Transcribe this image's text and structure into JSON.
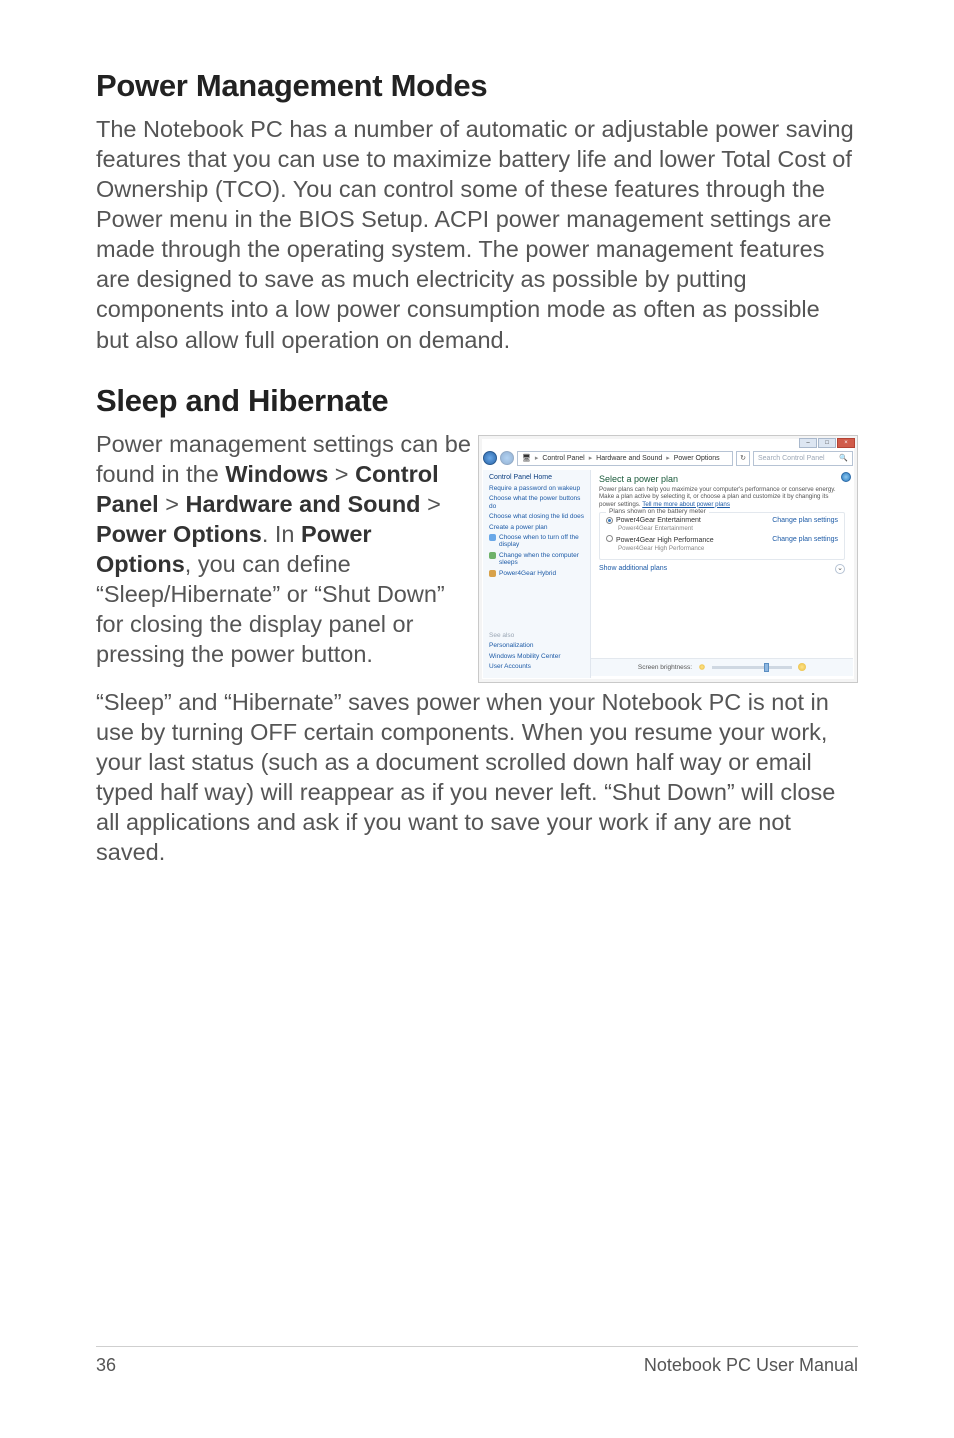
{
  "headings": {
    "h1": "Power Management Modes",
    "h2": "Sleep and Hibernate"
  },
  "paragraphs": {
    "p1": "The Notebook PC has a number of automatic or adjustable power saving features that you can use to maximize battery life and lower Total Cost of Ownership (TCO). You can control some of these features through the Power menu in the BIOS Setup. ACPI power management settings are made through the operating system. The power management features are designed to save as much electricity as possible by putting components into a low power consumption mode as often as possible but also allow full operation on demand.",
    "p2_pre": "Power management settings can be found in the ",
    "p2_w": "Windows",
    "p2_gt1": " > ",
    "p2_cp": "Control Panel",
    "p2_gt2": " > ",
    "p2_hs": "Hardware and Sound",
    "p2_gt3": " > ",
    "p2_po": "Power Options",
    "p2_in": ". In ",
    "p2_po2": "Power Options",
    "p2_rest": ", you can define “Sleep/Hibernate” or “Shut Down” for closing the display panel or pressing the power button.",
    "p3": "“Sleep” and “Hibernate” saves power when your Notebook PC is not in use by turning OFF certain components. When you resume your work, your last status (such as a document scrolled down half way or email typed half way) will reappear as if you never left. “Shut Down” will close all applications and ask if you want to save your work if any are not saved."
  },
  "screenshot": {
    "breadcrumb": {
      "seg1": "Control Panel",
      "seg2": "Hardware and Sound",
      "seg3": "Power Options"
    },
    "search_placeholder": "Search Control Panel",
    "sidebar": {
      "home": "Control Panel Home",
      "link1": "Require a password on wakeup",
      "link2": "Choose what the power buttons do",
      "link3": "Choose what closing the lid does",
      "link4": "Create a power plan",
      "link5": "Choose when to turn off the display",
      "link6": "Change when the computer sleeps",
      "link7": "Power4Gear Hybrid",
      "seealso": "See also",
      "sa1": "Personalization",
      "sa2": "Windows Mobility Center",
      "sa3": "User Accounts"
    },
    "main": {
      "title": "Select a power plan",
      "desc_a": "Power plans can help you maximize your computer's performance or conserve energy. Make a plan active by selecting it, or choose a plan and customize it by changing its power settings. ",
      "desc_link": "Tell me more about power plans",
      "legend": "Plans shown on the battery meter",
      "plan1": "Power4Gear Entertainment",
      "plan1_sub": "Power4Gear Entertainment",
      "plan2": "Power4Gear High Performance",
      "plan2_sub": "Power4Gear High Performance",
      "change": "Change plan settings",
      "show_more": "Show additional plans",
      "brightness": "Screen brightness:"
    }
  },
  "footer": {
    "page": "36",
    "manual": "Notebook PC User Manual"
  }
}
